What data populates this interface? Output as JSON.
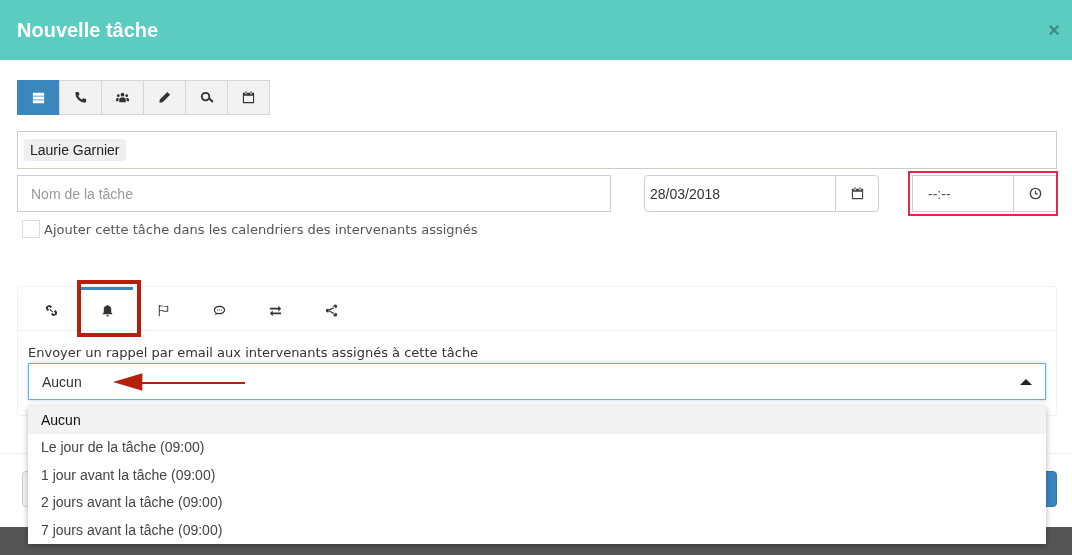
{
  "window": {
    "title": "Nouvelle tâche",
    "close": "×"
  },
  "toolbar": [
    {
      "kind": "list",
      "selected": true
    },
    {
      "kind": "phone",
      "selected": false
    },
    {
      "kind": "users",
      "selected": false
    },
    {
      "kind": "pencil",
      "selected": false
    },
    {
      "kind": "search",
      "selected": false
    },
    {
      "kind": "calendar",
      "selected": false
    }
  ],
  "assignees": [
    "Laurie Garnier"
  ],
  "task_name": {
    "placeholder": "Nom de la tâche"
  },
  "date": {
    "value": "28/03/2018"
  },
  "time": {
    "placeholder": "--:--"
  },
  "calendar_option": {
    "label": "Ajouter cette tâche dans les calendriers des intervenants assignés",
    "checked": false
  },
  "tabs": [
    {
      "kind": "link",
      "selected": false
    },
    {
      "kind": "bell",
      "selected": true
    },
    {
      "kind": "flag",
      "selected": false
    },
    {
      "kind": "comment",
      "selected": false
    },
    {
      "kind": "exchange",
      "selected": false
    },
    {
      "kind": "share",
      "selected": false
    }
  ],
  "reminder": {
    "label": "Envoyer un rappel par email aux intervenants assignés à cette tâche",
    "value": "Aucun",
    "options": [
      {
        "label": "Aucun",
        "selected": true
      },
      {
        "label": "Le jour de la tâche (09:00)",
        "selected": false
      },
      {
        "label": "1 jour avant la tâche (09:00)",
        "selected": false
      },
      {
        "label": "2 jours avant la tâche (09:00)",
        "selected": false
      },
      {
        "label": "7 jours avant la tâche (09:00)",
        "selected": false
      }
    ]
  }
}
